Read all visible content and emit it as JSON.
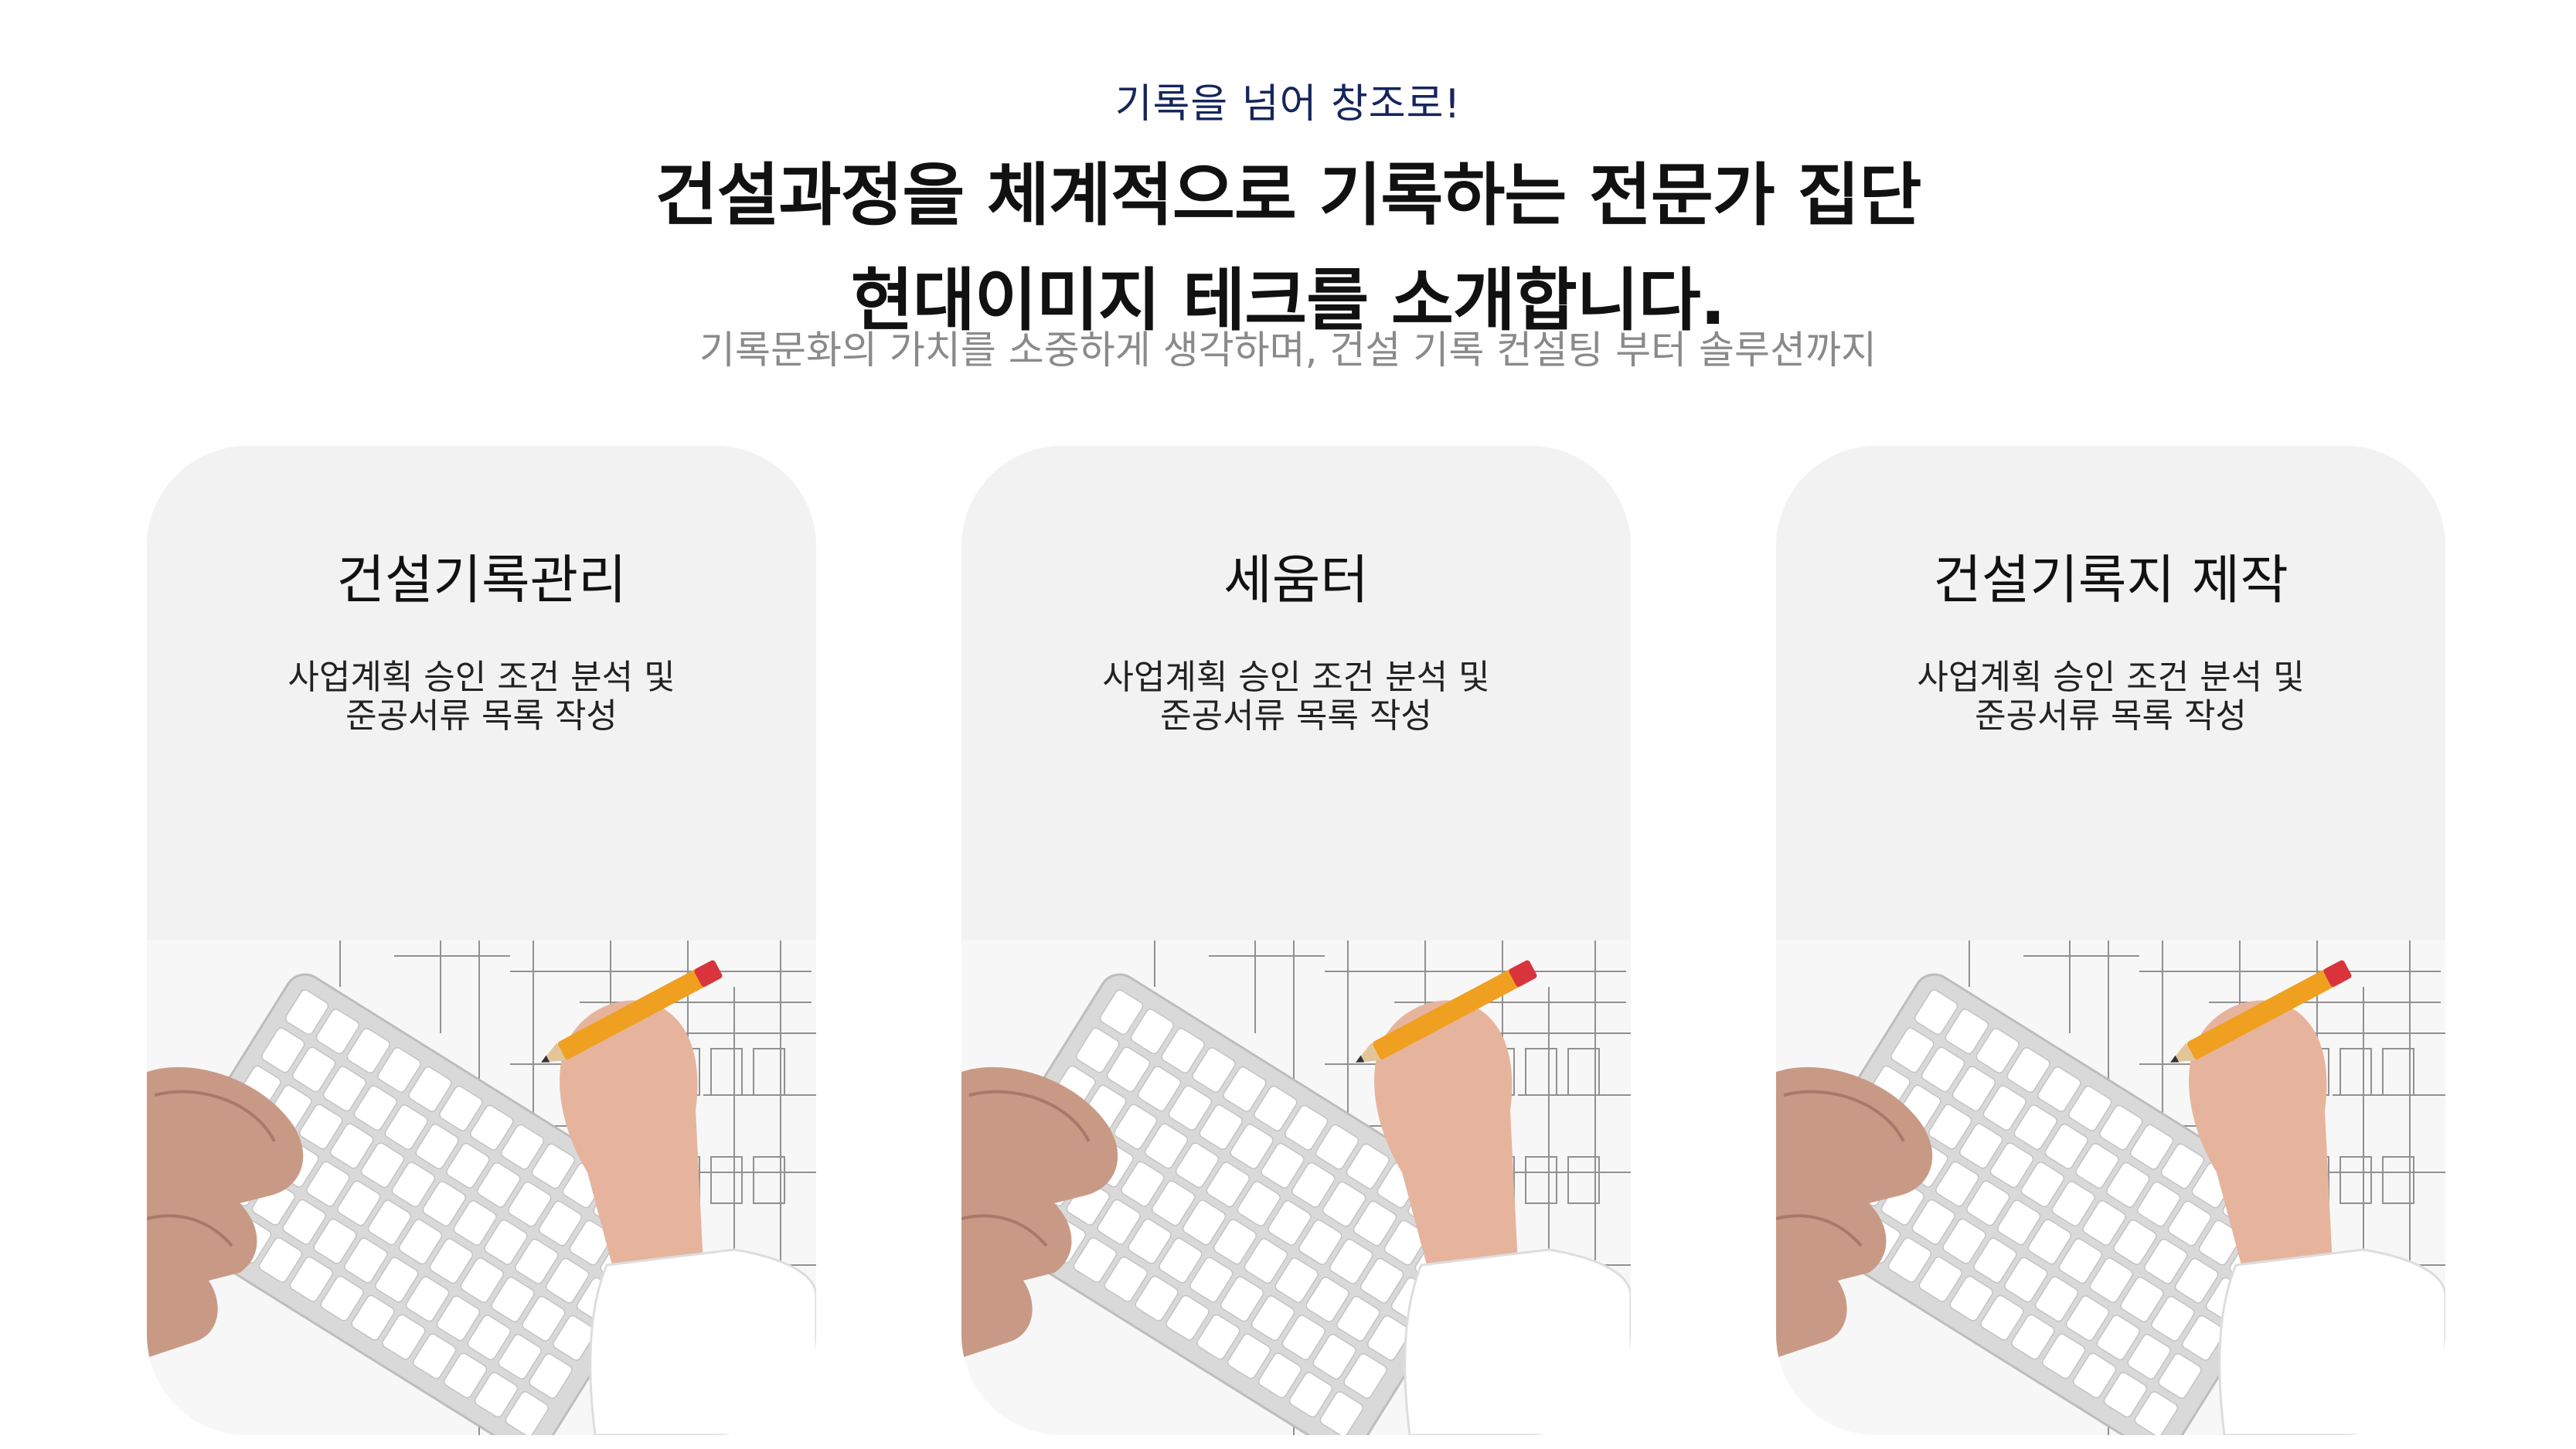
{
  "hero": {
    "eyebrow": "기록을 넘어 창조로!",
    "headline_line1": "건설과정을 체계적으로 기록하는 전문가 집단",
    "headline_line2": "현대이미지 테크를 소개합니다.",
    "subline": "기록문화의 가치를 소중하게 생각하며, 건설 기록 컨설팅 부터 솔루션까지"
  },
  "cards": [
    {
      "title": "건설기록관리",
      "desc_line1": "사업계획 승인 조건 분석 및",
      "desc_line2": "준공서류 목록 작성"
    },
    {
      "title": "세움터",
      "desc_line1": "사업계획 승인 조건 분석 및",
      "desc_line2": "준공서류 목록 작성"
    },
    {
      "title": "건설기록지 제작",
      "desc_line1": "사업계획 승인 조건 분석 및",
      "desc_line2": "준공서류 목록 작성"
    }
  ],
  "colors": {
    "eyebrow": "#16265c",
    "headline": "#111111",
    "subline": "#8a8a8a",
    "card_bg": "#f2f2f2"
  }
}
